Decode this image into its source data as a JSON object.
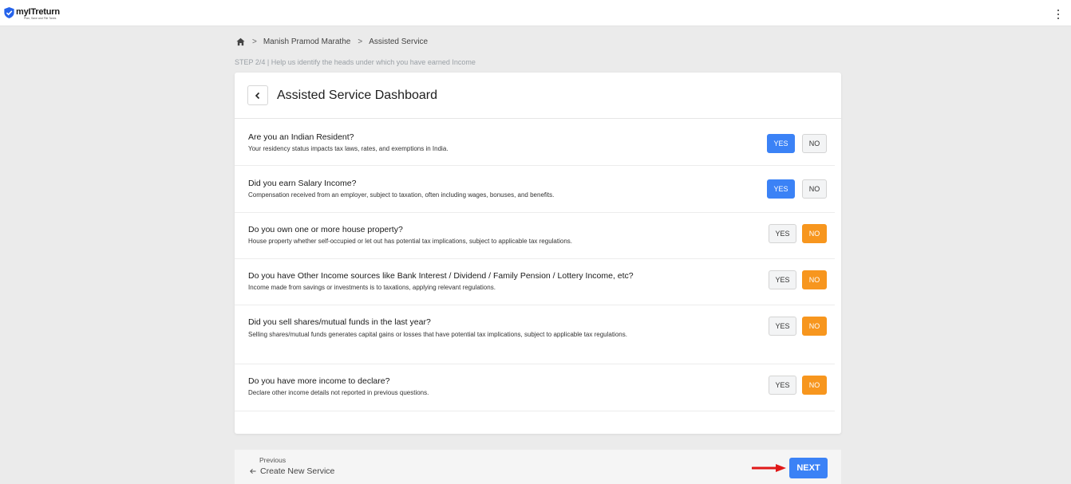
{
  "app": {
    "logo_name": "myITreturn",
    "logo_tagline": "Plan, Save and File Taxes"
  },
  "breadcrumb": {
    "items": [
      "Manish Pramod Marathe",
      "Assisted Service"
    ],
    "separator": ">"
  },
  "step_text": "STEP 2/4 | Help us identify the heads under which you have earned Income",
  "card": {
    "title": "Assisted Service Dashboard"
  },
  "questions": [
    {
      "title": "Are you an Indian Resident?",
      "description": "Your residency status impacts tax laws, rates, and exemptions in India.",
      "yes_label": "YES",
      "no_label": "NO",
      "selected": "yes"
    },
    {
      "title": "Did you earn Salary Income?",
      "description": "Compensation received from an employer, subject to taxation, often including wages, bonuses, and benefits.",
      "yes_label": "YES",
      "no_label": "NO",
      "selected": "yes"
    },
    {
      "title": "Do you own one or more house property?",
      "description": "House property whether self-occupied or let out has potential tax implications, subject to applicable tax regulations.",
      "yes_label": "YES",
      "no_label": "NO",
      "selected": "no"
    },
    {
      "title": "Do you have Other Income sources like Bank Interest / Dividend / Family Pension / Lottery Income, etc?",
      "description": "Income made from savings or investments is to taxations, applying relevant regulations.",
      "yes_label": "YES",
      "no_label": "NO",
      "selected": "no"
    },
    {
      "title": "Did you sell shares/mutual funds in the last year?",
      "description": "Selling shares/mutual funds generates capital gains or losses that have potential tax implications, subject to applicable tax regulations.",
      "yes_label": "YES",
      "no_label": "NO",
      "selected": "no"
    },
    {
      "title": "Do you have more income to declare?",
      "description": "Declare other income details not reported in previous questions.",
      "yes_label": "YES",
      "no_label": "NO",
      "selected": "no"
    }
  ],
  "footer": {
    "previous_label": "Previous",
    "previous_link": "Create New Service",
    "next_label": "NEXT"
  },
  "colors": {
    "primary_blue": "#3b82f6",
    "selected_no_orange": "#f7961e",
    "annotation_arrow": "#e01818"
  },
  "icons": [
    "shield-check-icon",
    "kebab-menu-icon",
    "home-icon",
    "chevron-left-icon",
    "arrow-left-icon",
    "red-arrow-annotation"
  ]
}
